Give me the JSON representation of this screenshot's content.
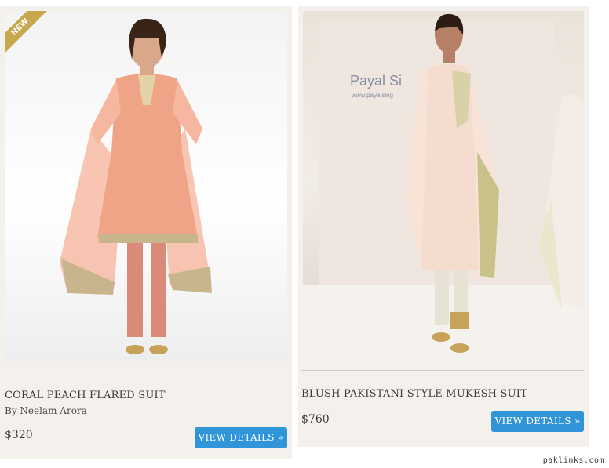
{
  "products": [
    {
      "badge": "NEW",
      "title": "CORAL PEACH FLARED SUIT",
      "designer": "By Neelam Arora",
      "price": "$320",
      "button_label": "VIEW DETAILS »",
      "colors": {
        "garment": "#f0a487",
        "trim": "#c9b58c",
        "pants": "#d98a78"
      }
    },
    {
      "title": "BLUSH PAKISTANI STYLE MUKESH SUIT",
      "price": "$760",
      "button_label": "VIEW DETAILS »",
      "backdrop_text": "Payal Si",
      "backdrop_url": "www.payalsing",
      "colors": {
        "garment": "#f4dccf",
        "trim": "#c8c28a",
        "pants": "#e6e2d4"
      }
    }
  ],
  "watermark": "paklinks.com",
  "accent_color": "#2f94d8"
}
